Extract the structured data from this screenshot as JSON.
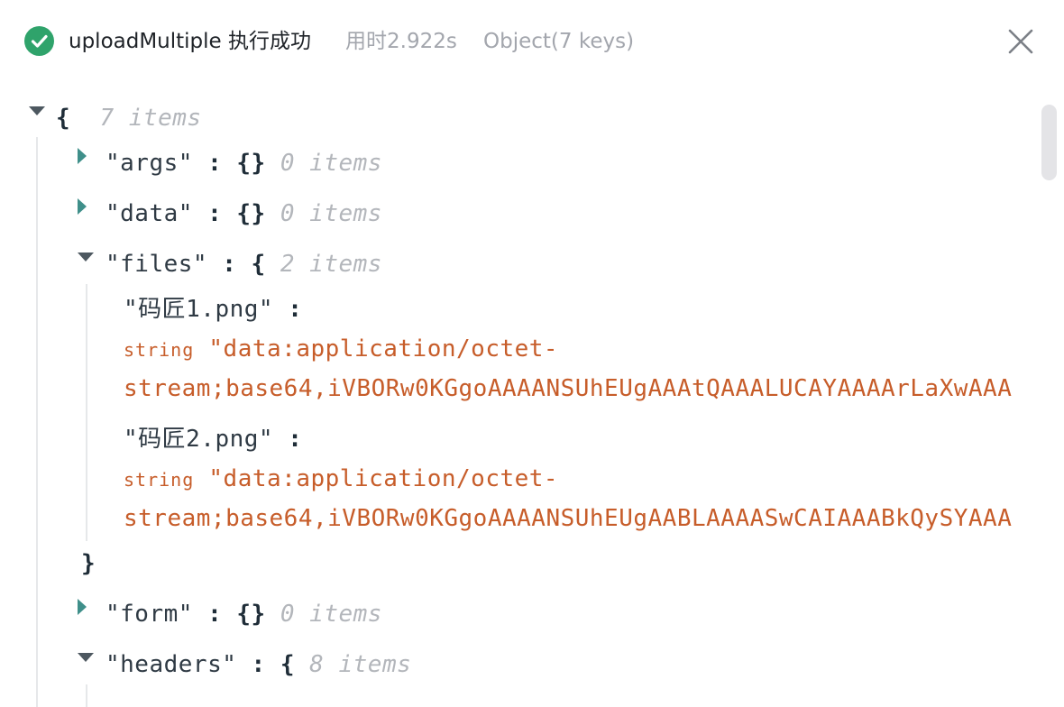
{
  "header": {
    "title": "uploadMultiple 执行成功",
    "duration": "用时2.922s",
    "summary": "Object(7 keys)",
    "icons": {
      "status": "check-circle-icon",
      "close": "close-icon"
    },
    "colors": {
      "success": "#2fa36b",
      "string": "#c75d2a",
      "muted": "#b3b6bb"
    }
  },
  "tree": {
    "root_open": "{",
    "root_count": "7 items",
    "args": {
      "key": "\"args\"",
      "colon": ":",
      "value": "{}",
      "count": "0 items"
    },
    "data": {
      "key": "\"data\"",
      "colon": ":",
      "value": "{}",
      "count": "0 items"
    },
    "files": {
      "key": "\"files\"",
      "colon": ":",
      "open": "{",
      "count": "2 items",
      "close": "}",
      "items": [
        {
          "key": "\"码匠1.png\"",
          "colon": ":",
          "type": "string",
          "value_line1": "\"data:application/octet-",
          "value_line2": "stream;base64,iVBORw0KGgoAAAANSUhEUgAAAtQAAALUCAYAAAArLaXwAAA"
        },
        {
          "key": "\"码匠2.png\"",
          "colon": ":",
          "type": "string",
          "value_line1": "\"data:application/octet-",
          "value_line2": "stream;base64,iVBORw0KGgoAAAANSUhEUgAABLAAAASwCAIAAABkQySYAAA"
        }
      ]
    },
    "form": {
      "key": "\"form\"",
      "colon": ":",
      "value": "{}",
      "count": "0 items"
    },
    "headers": {
      "key": "\"headers\"",
      "colon": ":",
      "open": "{",
      "count": "8 items"
    }
  }
}
